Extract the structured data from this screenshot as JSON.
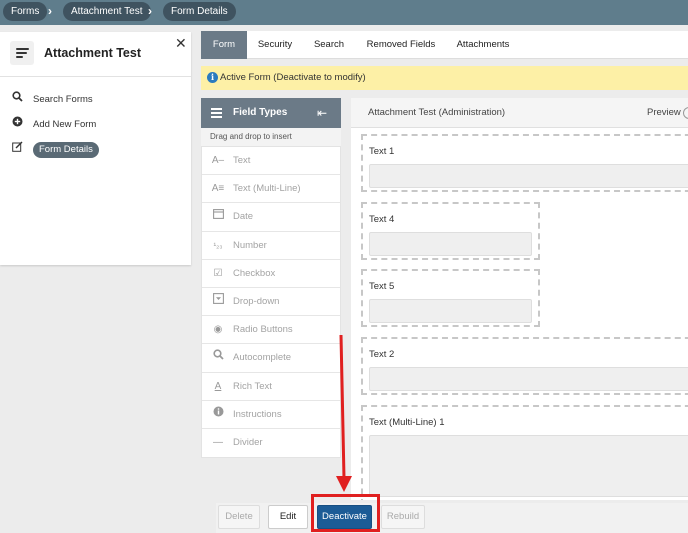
{
  "breadcrumbs": [
    "Forms",
    "Attachment Test",
    "Form Details"
  ],
  "left_panel": {
    "title": "Attachment Test",
    "items": [
      {
        "label": "Search Forms",
        "icon": "search-icon"
      },
      {
        "label": "Add New Form",
        "icon": "plus-circle-icon"
      },
      {
        "label": "Form Details",
        "icon": "edit-icon",
        "active": true
      }
    ]
  },
  "tabs": [
    "Form",
    "Security",
    "Search",
    "Removed Fields",
    "Attachments"
  ],
  "active_tab": "Form",
  "notice": "Active Form (Deactivate to modify)",
  "field_types": {
    "title": "Field Types",
    "hint": "Drag and drop to insert",
    "items": [
      {
        "label": "Text",
        "icon": "text-icon"
      },
      {
        "label": "Text (Multi-Line)",
        "icon": "multiline-text-icon"
      },
      {
        "label": "Date",
        "icon": "calendar-icon"
      },
      {
        "label": "Number",
        "icon": "number-icon"
      },
      {
        "label": "Checkbox",
        "icon": "checkbox-icon"
      },
      {
        "label": "Drop-down",
        "icon": "dropdown-icon"
      },
      {
        "label": "Radio Buttons",
        "icon": "radio-icon"
      },
      {
        "label": "Autocomplete",
        "icon": "search-icon"
      },
      {
        "label": "Rich Text",
        "icon": "rich-text-icon"
      },
      {
        "label": "Instructions",
        "icon": "info-icon"
      },
      {
        "label": "Divider",
        "icon": "divider-icon"
      }
    ]
  },
  "canvas": {
    "title": "Attachment Test (Administration)",
    "preview_label": "Preview",
    "fields": [
      "Text 1",
      "Text 4",
      "Text 5",
      "Text 2",
      "Text (Multi-Line) 1"
    ]
  },
  "buttons": {
    "delete": "Delete",
    "edit": "Edit",
    "deactivate": "Deactivate",
    "rebuild": "Rebuild"
  },
  "colors": {
    "topbar": "#5f7d8c",
    "primary": "#1c5c96",
    "highlight": "#e02020",
    "notice_bg": "#fdf0a6"
  }
}
